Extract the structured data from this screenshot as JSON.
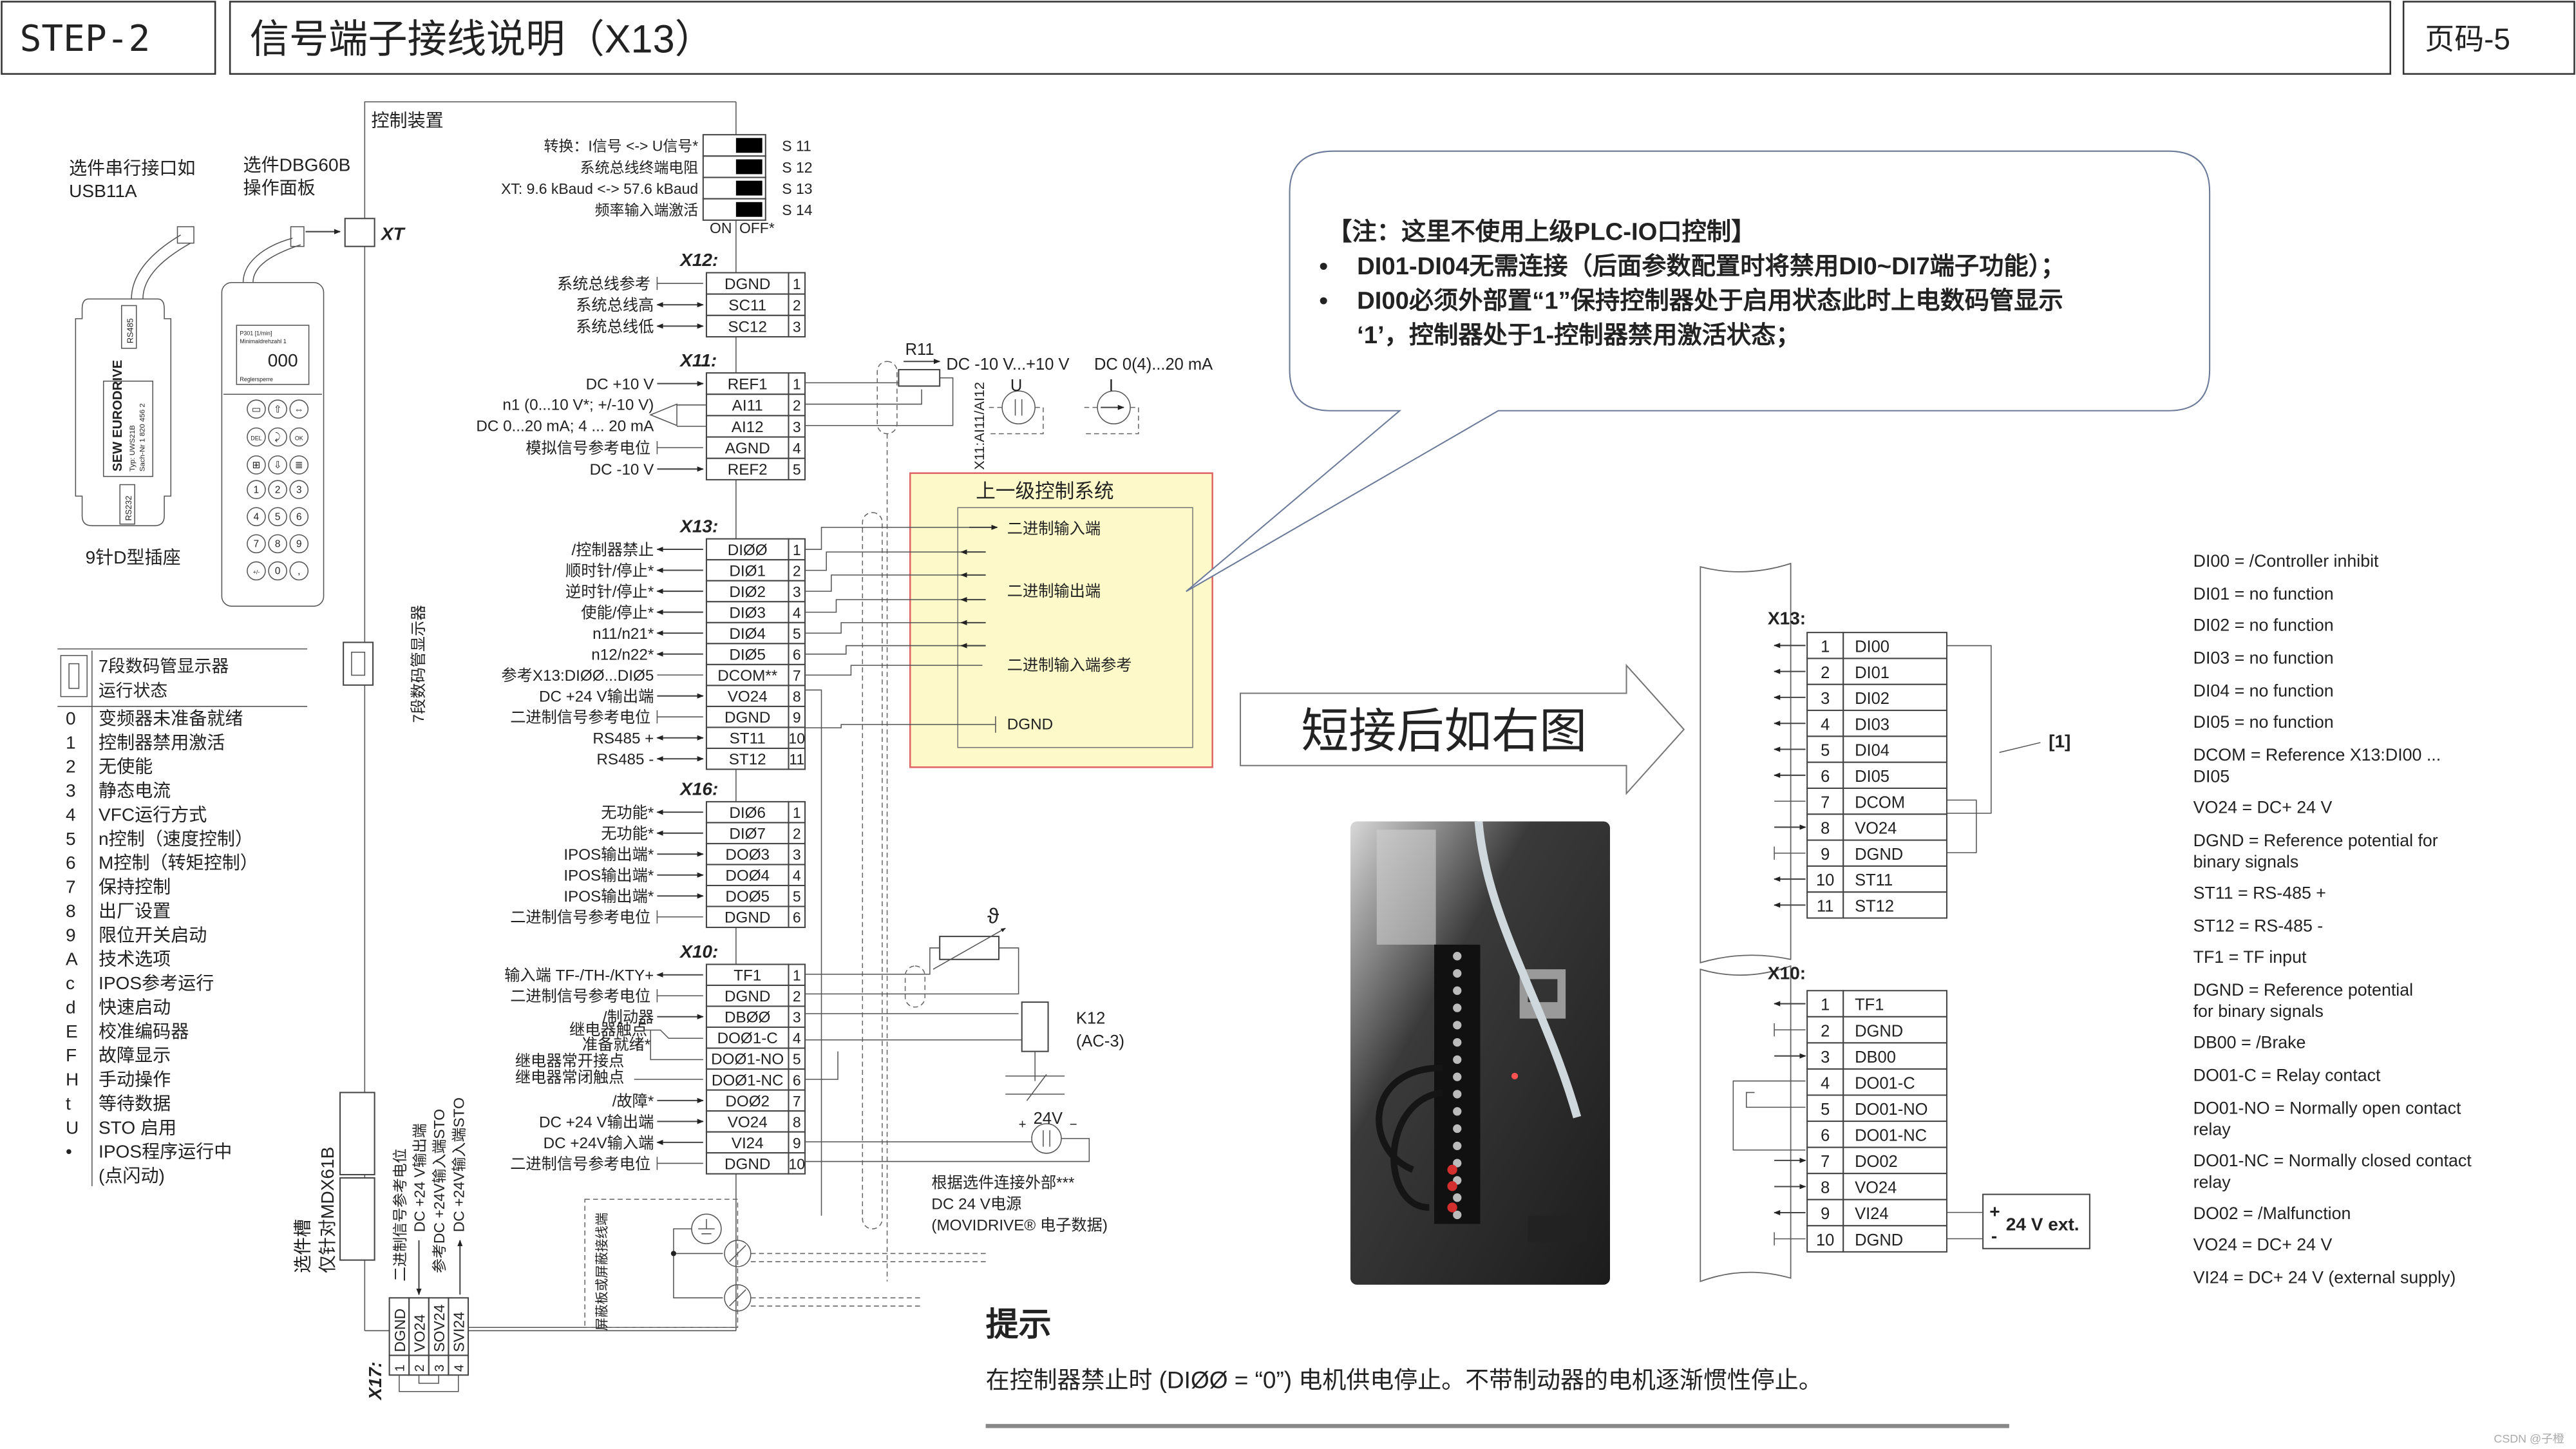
{
  "header": {
    "step": "STEP-2",
    "title": "信号端子接线说明（X13）",
    "page": "页码-5"
  },
  "left": {
    "serial_label": [
      "选件串行接口如",
      "USB11A"
    ],
    "dbg_label": [
      "选件DBG60B",
      "操作面板"
    ],
    "usb_device": {
      "port_top": "RS485",
      "port_bottom": "RS232",
      "logo": "SEW EURODRIVE",
      "type": "Typ:   UWS21B",
      "part": "Sach-Nr  1 820 456 2"
    },
    "keypad": {
      "screen_line1": "P301          [1/min]",
      "screen_line2": "Minimaldrehzahl 1",
      "screen_value": "000",
      "screen_status": "Reglersperre",
      "keys": [
        "▭",
        "⇧",
        "⇔",
        "DEL",
        "⤸",
        "OK",
        "⊞",
        "⇩",
        "≣",
        "1",
        "2",
        "3",
        "4",
        "5",
        "6",
        "7",
        "8",
        "9",
        "+/-",
        "0",
        ","
      ]
    },
    "dsub_label": "9针D型插座",
    "seg_title": [
      "7段数码管显示器",
      "运行状态"
    ],
    "states": [
      {
        "code": "0",
        "desc": "变频器未准备就绪"
      },
      {
        "code": "1",
        "desc": "控制器禁用激活"
      },
      {
        "code": "2",
        "desc": "无使能"
      },
      {
        "code": "3",
        "desc": "静态电流"
      },
      {
        "code": "4",
        "desc": "VFC运行方式"
      },
      {
        "code": "5",
        "desc": "n控制（速度控制）"
      },
      {
        "code": "6",
        "desc": "M控制（转矩控制）"
      },
      {
        "code": "7",
        "desc": "保持控制"
      },
      {
        "code": "8",
        "desc": "出厂设置"
      },
      {
        "code": "9",
        "desc": "限位开关启动"
      },
      {
        "code": "A",
        "desc": "技术选项"
      },
      {
        "code": "c",
        "desc": "IPOS参考运行"
      },
      {
        "code": "d",
        "desc": "快速启动"
      },
      {
        "code": "E",
        "desc": "校准编码器"
      },
      {
        "code": "F",
        "desc": "故障显示"
      },
      {
        "code": "H",
        "desc": "手动操作"
      },
      {
        "code": "t",
        "desc": "等待数据"
      },
      {
        "code": "U",
        "desc": "STO 启用"
      },
      {
        "code": "•",
        "desc": "IPOS程序运行中"
      }
    ],
    "state_last_extra": "(点闪动)",
    "seg_vertical": "7段数码管显示器",
    "slot_label": [
      "选件槽",
      "仅针对MDX61B"
    ]
  },
  "control": {
    "title": "控制装置",
    "xt": "XT",
    "dip": [
      {
        "label": "转换：I信号 <-> U信号*",
        "id": "S 11"
      },
      {
        "label": "系统总线终端电阻",
        "id": "S 12"
      },
      {
        "label": "XT: 9.6 kBaud <-> 57.6 kBaud",
        "id": "S 13"
      },
      {
        "label": "频率输入端激活",
        "id": "S 14"
      }
    ],
    "dip_on": "ON",
    "dip_off": "OFF*",
    "x12": {
      "label": "X12:",
      "rows": [
        {
          "name": "DGND",
          "num": "1",
          "desc": "系统总线参考",
          "dir": "ref"
        },
        {
          "name": "SC11",
          "num": "2",
          "desc": "系统总线高",
          "dir": "bi"
        },
        {
          "name": "SC12",
          "num": "3",
          "desc": "系统总线低",
          "dir": "bi"
        }
      ]
    },
    "x11": {
      "label": "X11:",
      "rows": [
        {
          "name": "REF1",
          "num": "1",
          "desc": "DC +10 V",
          "dir": "to"
        },
        {
          "name": "AI11",
          "num": "2",
          "desc": "n1 (0...10 V*; +/-10 V)",
          "dir": "amp"
        },
        {
          "name": "AI12",
          "num": "3",
          "desc": "DC 0...20 mA; 4 ... 20 mA",
          "dir": "amp"
        },
        {
          "name": "AGND",
          "num": "4",
          "desc": "模拟信号参考电位",
          "dir": "ref"
        },
        {
          "name": "REF2",
          "num": "5",
          "desc": "DC -10 V",
          "dir": "to"
        }
      ]
    },
    "x13": {
      "label": "X13:",
      "rows": [
        {
          "name": "DIØØ",
          "num": "1",
          "desc": "/控制器禁止",
          "dir": "from"
        },
        {
          "name": "DIØ1",
          "num": "2",
          "desc": "顺时针/停止*",
          "dir": "from"
        },
        {
          "name": "DIØ2",
          "num": "3",
          "desc": "逆时针/停止*",
          "dir": "from"
        },
        {
          "name": "DIØ3",
          "num": "4",
          "desc": "使能/停止*",
          "dir": "from"
        },
        {
          "name": "DIØ4",
          "num": "5",
          "desc": "n11/n21*",
          "dir": "from"
        },
        {
          "name": "DIØ5",
          "num": "6",
          "desc": "n12/n22*",
          "dir": "from"
        },
        {
          "name": "DCOM**",
          "num": "7",
          "desc": "参考X13:DIØØ...DIØ5",
          "dir": "line"
        },
        {
          "name": "VO24",
          "num": "8",
          "desc": "DC +24 V输出端",
          "dir": "to"
        },
        {
          "name": "DGND",
          "num": "9",
          "desc": "二进制信号参考电位",
          "dir": "ref"
        },
        {
          "name": "ST11",
          "num": "10",
          "desc": "RS485 +",
          "dir": "bi"
        },
        {
          "name": "ST12",
          "num": "11",
          "desc": "RS485 -",
          "dir": "bi"
        }
      ]
    },
    "x16": {
      "label": "X16:",
      "rows": [
        {
          "name": "DIØ6",
          "num": "1",
          "desc": "无功能*",
          "dir": "from"
        },
        {
          "name": "DIØ7",
          "num": "2",
          "desc": "无功能*",
          "dir": "from"
        },
        {
          "name": "DOØ3",
          "num": "3",
          "desc": "IPOS输出端*",
          "dir": "to"
        },
        {
          "name": "DOØ4",
          "num": "4",
          "desc": "IPOS输出端*",
          "dir": "to"
        },
        {
          "name": "DOØ5",
          "num": "5",
          "desc": "IPOS输出端*",
          "dir": "to"
        },
        {
          "name": "DGND",
          "num": "6",
          "desc": "二进制信号参考电位",
          "dir": "ref"
        }
      ]
    },
    "x10": {
      "label": "X10:",
      "rows": [
        {
          "name": "TF1",
          "num": "1",
          "desc": "输入端 TF-/TH-/KTY+",
          "dir": "from"
        },
        {
          "name": "DGND",
          "num": "2",
          "desc": "二进制信号参考电位",
          "dir": "ref"
        },
        {
          "name": "DBØØ",
          "num": "3",
          "desc": "/制动器",
          "dir": "to"
        },
        {
          "name": "DOØ1-C",
          "num": "4",
          "desc": "",
          "dir": "relay"
        },
        {
          "name": "DOØ1-NO",
          "num": "5",
          "desc": "",
          "dir": "relay"
        },
        {
          "name": "DOØ1-NC",
          "num": "6",
          "desc": "",
          "dir": "relay"
        },
        {
          "name": "DOØ2",
          "num": "7",
          "desc": "/故障*",
          "dir": "to"
        },
        {
          "name": "VO24",
          "num": "8",
          "desc": "DC +24 V输出端",
          "dir": "to"
        },
        {
          "name": "VI24",
          "num": "9",
          "desc": "DC +24V输入端",
          "dir": "from"
        },
        {
          "name": "DGND",
          "num": "10",
          "desc": "二进制信号参考电位",
          "dir": "ref"
        }
      ]
    },
    "relay_labels": [
      "继电器触点",
      "准备就绪*",
      "继电器常开接点",
      "继电器常闭触点"
    ],
    "x17": {
      "label": "X17:",
      "rows": [
        {
          "name": "DGND",
          "num": "1",
          "desc": "二进制信号参考电位"
        },
        {
          "name": "VO24",
          "num": "2",
          "desc": "DC +24 V输出端"
        },
        {
          "name": "SOV24",
          "num": "3",
          "desc": "参考DC +24V输入端STO"
        },
        {
          "name": "SVI24",
          "num": "4",
          "desc": "DC +24V输入端STO"
        }
      ]
    },
    "shield_label": "屏蔽板或屏蔽接线端",
    "r11": "R11",
    "range_label": "DC -10 V...+10 V",
    "current_label": "DC 0(4)...20 mA",
    "ai_vertical": "X11:AI11/AI12",
    "u_label": "U",
    "i_label": "I",
    "theta": "ϑ",
    "k12": "K12",
    "k12_sub": "(AC-3)",
    "v24": "24V",
    "ext_supply": [
      "根据选件连接外部***",
      "DC 24 V电源",
      "(MOVIDRIVE® 电子数据)"
    ]
  },
  "upper_system": {
    "title": "上一级控制系统",
    "binary_inputs": "二进制输入端",
    "binary_outputs": "二进制输出端",
    "binary_input_ref": "二进制输入端参考",
    "dgnd": "DGND",
    "highlight_fill": "#fdf9c8",
    "highlight_border": "#e06666"
  },
  "note": {
    "title": "【注：这里不使用上级PLC-IO口控制】",
    "bullets": [
      "DI01-DI04无需连接（后面参数配置时将禁用DI0~DI7端子功能）；",
      "DI00必须外部置“1”保持控制器处于启用状态此时上电数码管显示"
    ],
    "bullet2_cont": "‘1’，控制器处于1-控制器禁用激活状态；"
  },
  "arrow_callout": "短接后如右图",
  "right_diagram": {
    "x13_label": "X13:",
    "x13_rows": [
      {
        "num": "1",
        "name": "DI00",
        "dir": "from"
      },
      {
        "num": "2",
        "name": "DI01",
        "dir": "from"
      },
      {
        "num": "3",
        "name": "DI02",
        "dir": "from"
      },
      {
        "num": "4",
        "name": "DI03",
        "dir": "from"
      },
      {
        "num": "5",
        "name": "DI04",
        "dir": "from"
      },
      {
        "num": "6",
        "name": "DI05",
        "dir": "from"
      },
      {
        "num": "7",
        "name": "DCOM",
        "dir": "line"
      },
      {
        "num": "8",
        "name": "VO24",
        "dir": "to"
      },
      {
        "num": "9",
        "name": "DGND",
        "dir": "ref"
      },
      {
        "num": "10",
        "name": "ST11",
        "dir": "from"
      },
      {
        "num": "11",
        "name": "ST12",
        "dir": "from"
      }
    ],
    "jumper_label": "[1]",
    "x10_label": "X10:",
    "x10_rows": [
      {
        "num": "1",
        "name": "TF1",
        "dir": "from"
      },
      {
        "num": "2",
        "name": "DGND",
        "dir": "ref"
      },
      {
        "num": "3",
        "name": "DB00",
        "dir": "to"
      },
      {
        "num": "4",
        "name": "DO01-C",
        "dir": "relay"
      },
      {
        "num": "5",
        "name": "DO01-NO",
        "dir": "relay"
      },
      {
        "num": "6",
        "name": "DO01-NC",
        "dir": "relay"
      },
      {
        "num": "7",
        "name": "DO02",
        "dir": "to"
      },
      {
        "num": "8",
        "name": "VO24",
        "dir": "to"
      },
      {
        "num": "9",
        "name": "VI24",
        "dir": "from"
      },
      {
        "num": "10",
        "name": "DGND",
        "dir": "ref"
      }
    ],
    "ext_plus": "+",
    "ext_minus": "-",
    "ext_label": "24 V ext."
  },
  "legend": [
    [
      "DI00 = /Controller inhibit"
    ],
    [
      "DI01 = no function"
    ],
    [
      "DI02 = no function"
    ],
    [
      "DI03 = no function"
    ],
    [
      "DI04 = no function"
    ],
    [
      "DI05 = no function"
    ],
    [
      "DCOM = Reference X13:DI00 ...",
      "DI05"
    ],
    [
      "VO24 = DC+ 24 V"
    ],
    [
      "DGND = Reference potential for",
      "binary signals"
    ],
    [
      "ST11 = RS-485 +"
    ],
    [
      "ST12 = RS-485 -"
    ],
    [
      "TF1 = TF input"
    ],
    [
      "DGND = Reference potential",
      "for binary signals"
    ],
    [
      "DB00 = /Brake"
    ],
    [
      "DO01-C = Relay contact"
    ],
    [
      "DO01-NO = Normally open contact",
      "relay"
    ],
    [
      "DO01-NC = Normally closed contact",
      "relay"
    ],
    [
      "DO02 = /Malfunction"
    ],
    [
      "VO24 = DC+ 24 V"
    ],
    [
      "VI24 = DC+ 24 V (external supply)"
    ]
  ],
  "tip": {
    "title": "提示",
    "text": "在控制器禁止时 (DIØØ = “0”) 电机供电停止。不带制动器的电机逐渐惯性停止。"
  },
  "watermark": "CSDN @子橙"
}
